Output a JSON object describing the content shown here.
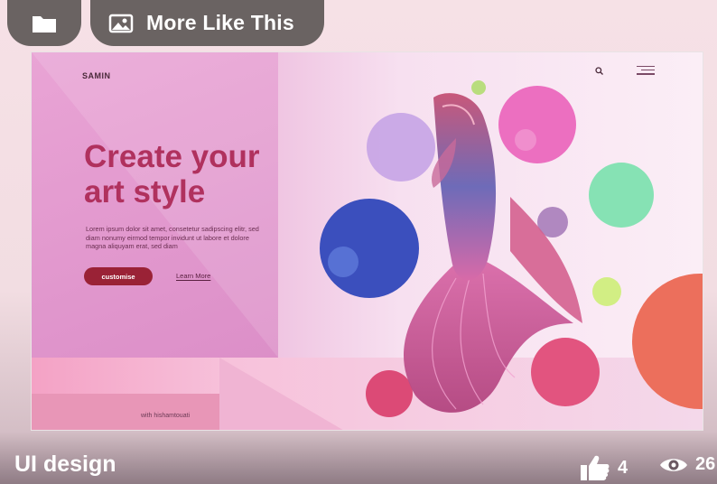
{
  "toolbar": {
    "folder_icon": "folder-icon",
    "more_like_this_label": "More Like This",
    "more_like_this_icon": "image-icon"
  },
  "artwork": {
    "logo": "SAMIN",
    "headline_line1": "Create your",
    "headline_line2": "art style",
    "body_copy": "Lorem ipsum dolor sit amet, consetetur sadipscing elitr, sed diam nonumy eirmod tempor invidunt ut labore et dolore magna aliquyam erat, sed diam",
    "cta_label": "customise",
    "learn_more_label": "Learn More",
    "credit": "with hishamtouati",
    "search_icon": "search-icon",
    "menu_icon": "menu-icon",
    "colors": {
      "headline": "#b0315e",
      "cta": "#9a2236",
      "accent_pink": "#ef6fbf",
      "accent_blue": "#3b4fbd",
      "accent_green": "#86e2b4",
      "accent_coral": "#ec6f5c"
    }
  },
  "project": {
    "title": "UI design",
    "likes": "4",
    "views": "26",
    "like_icon": "thumbs-up-icon",
    "view_icon": "eye-icon"
  }
}
